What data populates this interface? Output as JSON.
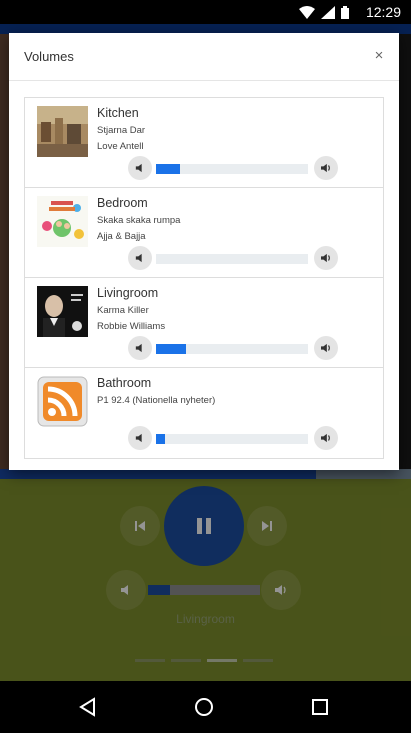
{
  "status_bar": {
    "time": "12:29"
  },
  "dialog": {
    "title": "Volumes",
    "close": "×",
    "zones": [
      {
        "room": "Kitchen",
        "line1": "Stjarna Dar",
        "line2": "Love Antell",
        "volume_fraction": 0.16,
        "art": "album-art-kitchen"
      },
      {
        "room": "Bedroom",
        "line1": "Skaka skaka rumpa",
        "line2": "Ajja & Bajja",
        "volume_fraction": 0.0,
        "art": "album-art-bedroom"
      },
      {
        "room": "Livingroom",
        "line1": "Karma Killer",
        "line2": "Robbie Williams",
        "volume_fraction": 0.2,
        "art": "album-art-livingroom"
      },
      {
        "room": "Bathroom",
        "line1": "P1 92.4 (Nationella nyheter)",
        "line2": "",
        "volume_fraction": 0.06,
        "art": "rss-icon"
      }
    ]
  },
  "background_player": {
    "room_label": "Livingroom",
    "volume_fraction": 0.2,
    "progress_fraction": 0.77
  },
  "colors": {
    "accent": "#1a72e8",
    "dialog_bg": "#ffffff",
    "player_green": "#7f8f2d",
    "play_blue": "#1c4fa3"
  }
}
